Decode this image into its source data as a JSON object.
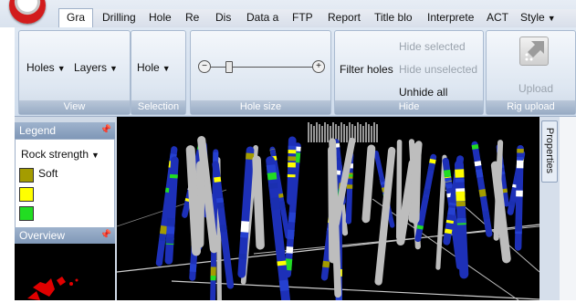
{
  "tabs": [
    {
      "label": "Gra",
      "active": true
    },
    {
      "label": "Drilling"
    },
    {
      "label": "Hole"
    },
    {
      "label": "Re"
    },
    {
      "label": "Dis"
    },
    {
      "label": "Data a"
    },
    {
      "label": "FTP"
    },
    {
      "label": "Report"
    },
    {
      "label": "Title blo"
    },
    {
      "label": "Interprete"
    },
    {
      "label": "ACT"
    },
    {
      "label": "Style"
    }
  ],
  "ribbon": {
    "view": {
      "label": "View",
      "holes": "Holes",
      "layers": "Layers"
    },
    "selection": {
      "label": "Selection",
      "hole": "Hole"
    },
    "hole_size": {
      "label": "Hole size",
      "minus": "−",
      "plus": "+"
    },
    "hide": {
      "label": "Hide",
      "filter_holes": "Filter holes",
      "hide_selected": "Hide selected",
      "hide_unselected": "Hide unselected",
      "unhide_all": "Unhide all"
    },
    "rig_upload": {
      "label": "Rig upload",
      "upload": "Upload"
    }
  },
  "legend": {
    "title": "Legend",
    "mode": "Rock strength",
    "items": [
      {
        "label": "Soft",
        "color": "#a49c00"
      },
      {
        "label": "",
        "color": "#ffff00"
      },
      {
        "label": "",
        "color": "#22dd22"
      }
    ]
  },
  "overview": {
    "title": "Overview"
  },
  "properties_tab": "Properties",
  "icons": {
    "pin": "pin-icon",
    "dropdown": "chevron-down-icon"
  }
}
